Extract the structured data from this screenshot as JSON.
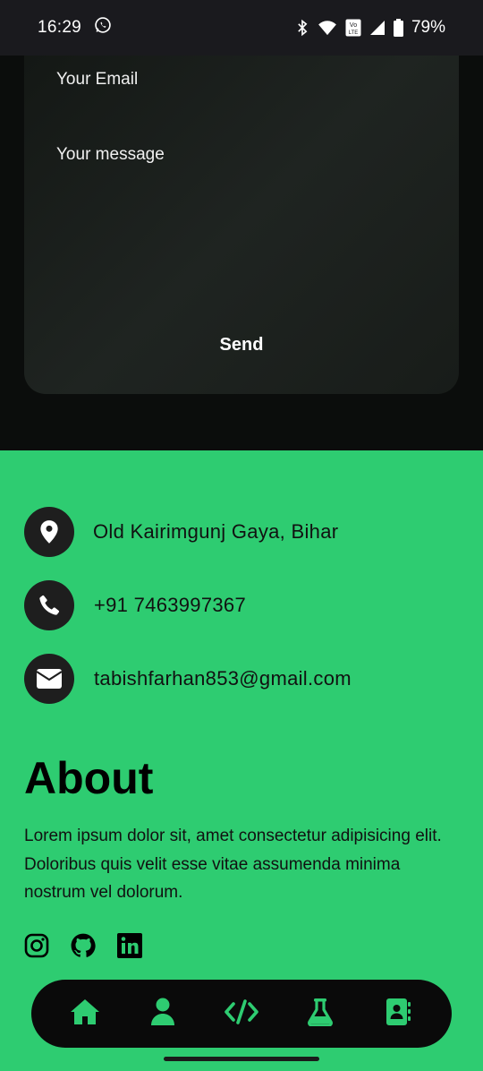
{
  "status_bar": {
    "time": "16:29",
    "battery": "79%",
    "network_badge": "Vo LTE",
    "icons": [
      "whatsapp-icon",
      "bluetooth-icon",
      "wifi-icon",
      "volte-icon",
      "signal-icon",
      "battery-icon"
    ]
  },
  "contact_form": {
    "email_placeholder": "Your Email",
    "message_placeholder": "Your message",
    "send_label": "Send"
  },
  "contact_info": {
    "address": "Old Kairimgunj Gaya, Bihar",
    "phone": "+91 7463997367",
    "email": "tabishfarhan853@gmail.com"
  },
  "about": {
    "title": "About",
    "text": "Lorem ipsum dolor sit, amet consectetur adipisicing elit. Doloribus quis velit esse vitae assumenda minima nostrum vel dolorum."
  },
  "social_links": [
    "instagram-icon",
    "github-icon",
    "linkedin-icon"
  ],
  "bottom_nav": [
    "home-icon",
    "user-icon",
    "code-icon",
    "flask-icon",
    "contact-book-icon"
  ],
  "colors": {
    "accent": "#2ecc71",
    "dark_bg": "#0b0d0c",
    "card_bg": "#1c201d",
    "nav_bg": "#0a0a0a"
  }
}
